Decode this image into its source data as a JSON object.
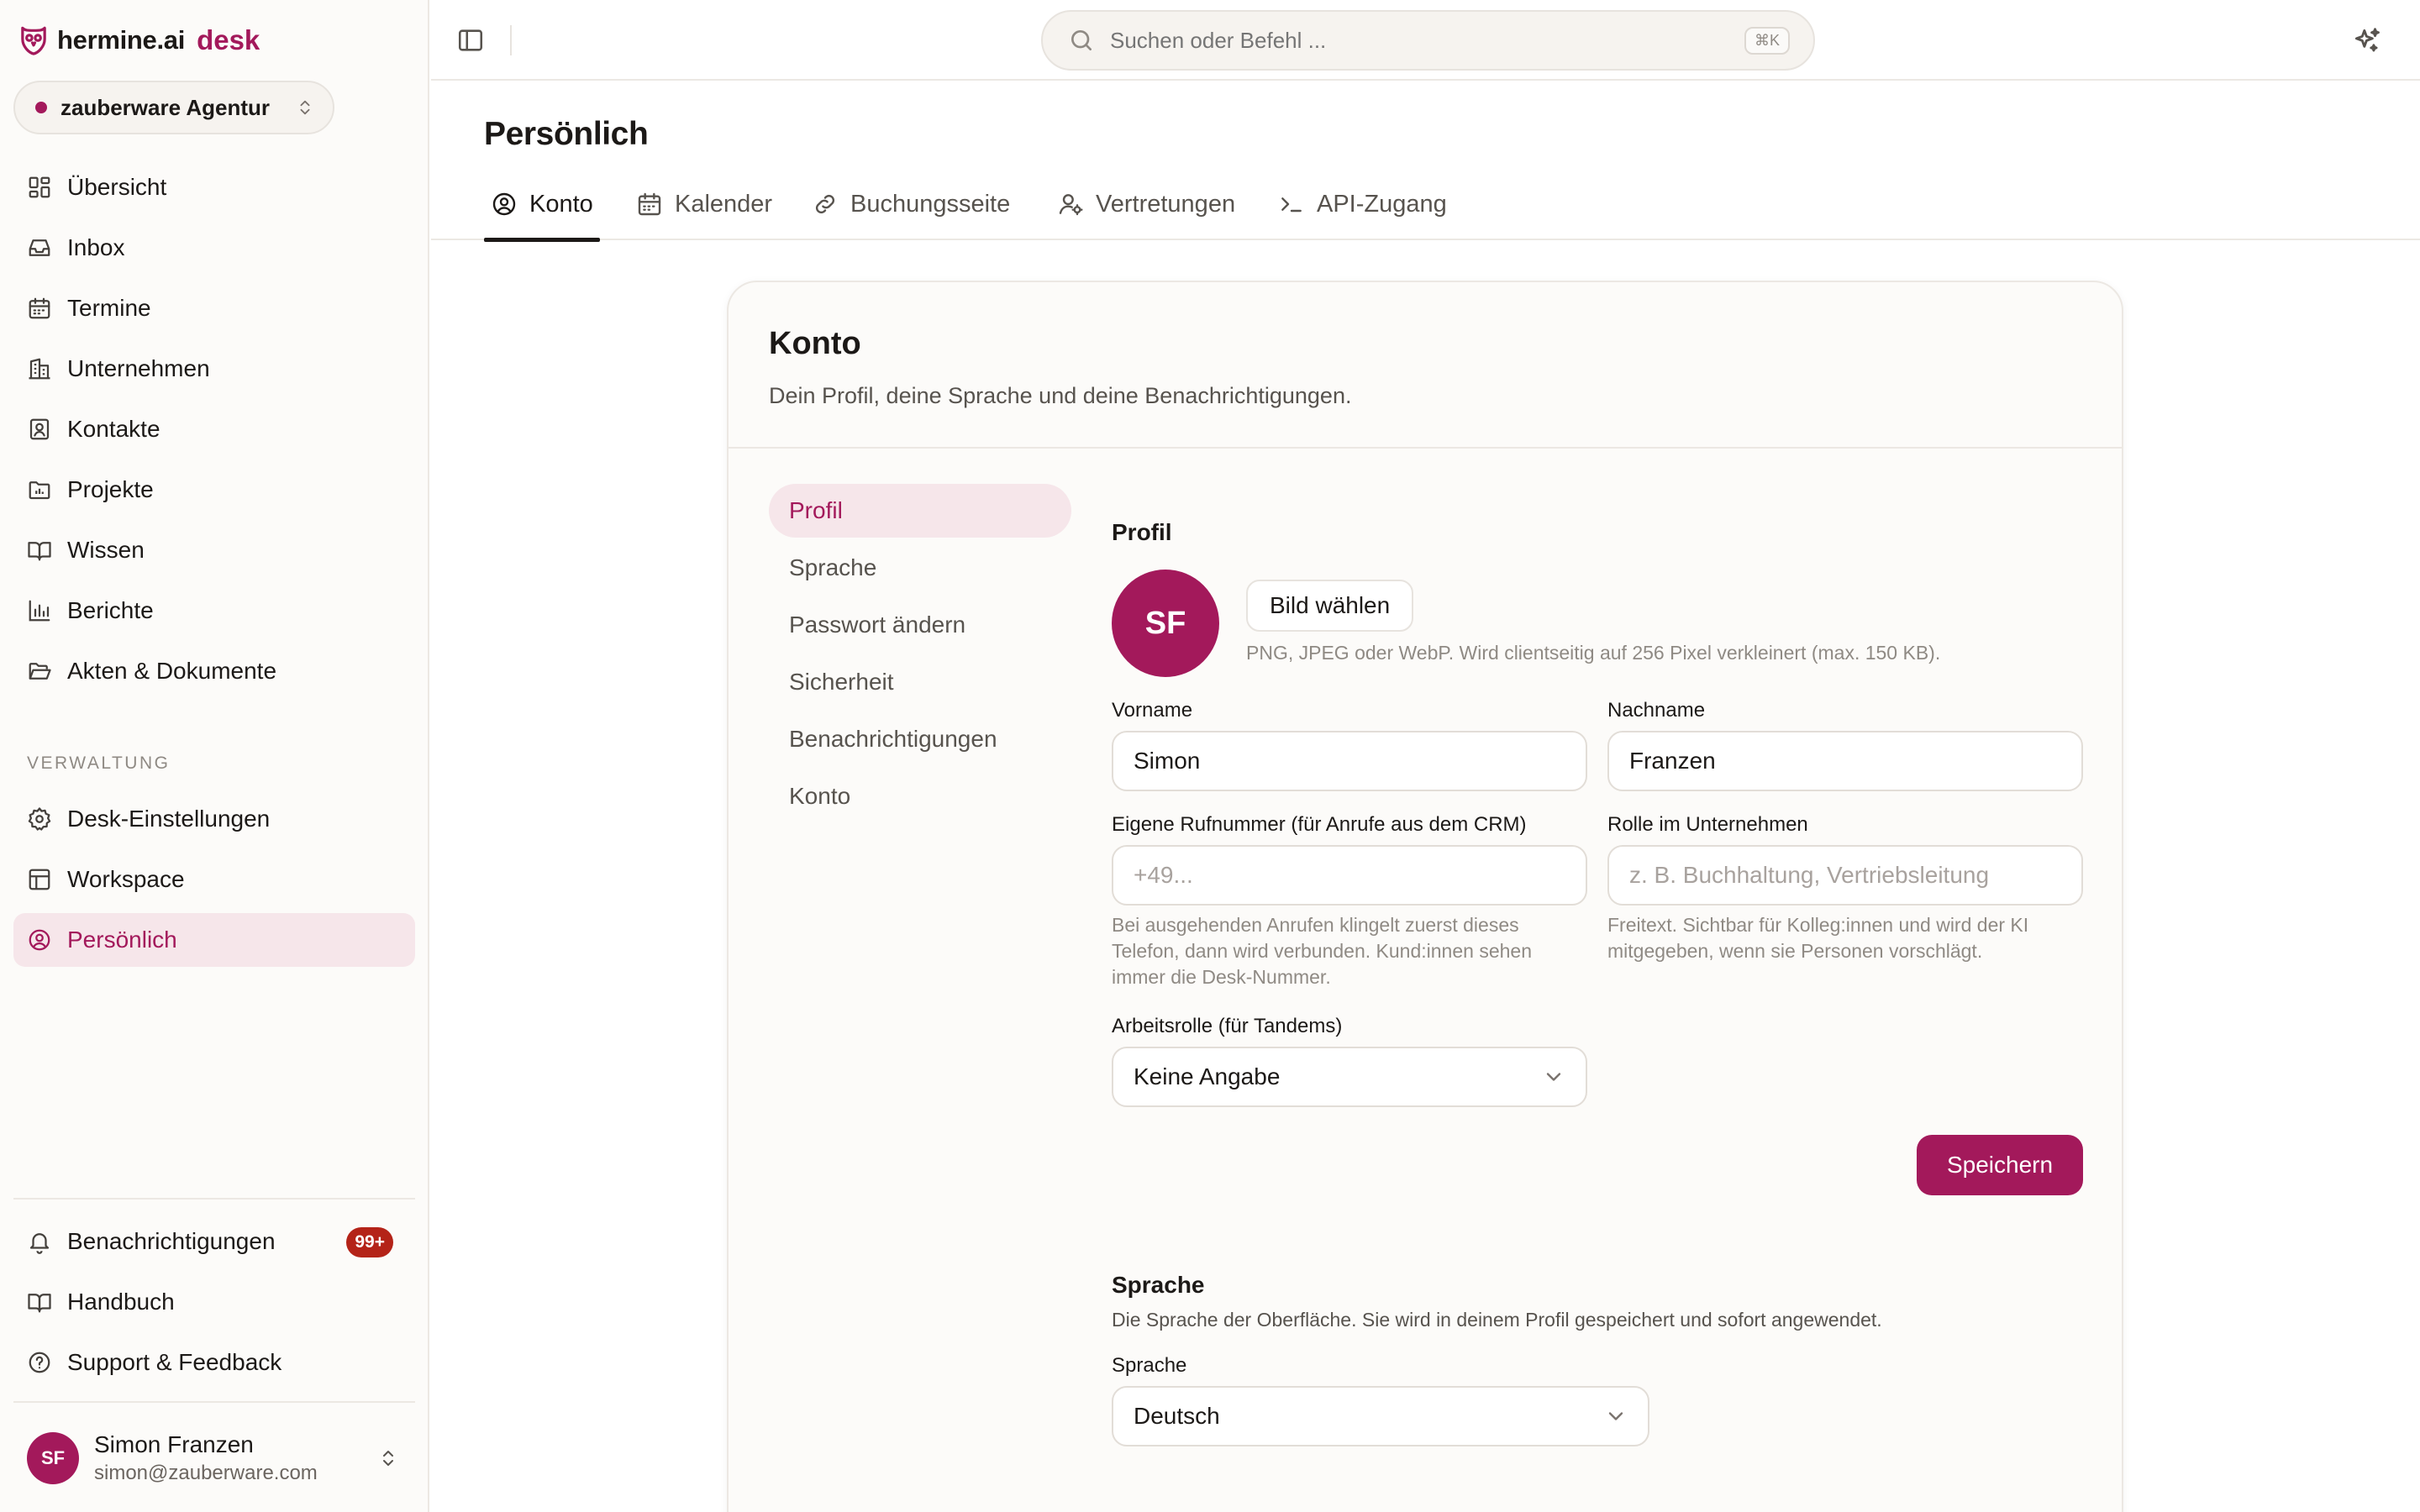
{
  "brand": {
    "name": "hermine.ai",
    "product": "desk"
  },
  "org_switcher": {
    "name": "zauberware Agentur"
  },
  "sidebar": {
    "nav": [
      {
        "label": "Übersicht",
        "icon": "dashboard-icon"
      },
      {
        "label": "Inbox",
        "icon": "inbox-icon"
      },
      {
        "label": "Termine",
        "icon": "calendar-icon"
      },
      {
        "label": "Unternehmen",
        "icon": "building-icon"
      },
      {
        "label": "Kontakte",
        "icon": "contact-icon"
      },
      {
        "label": "Projekte",
        "icon": "folder-chart-icon"
      },
      {
        "label": "Wissen",
        "icon": "book-icon"
      },
      {
        "label": "Berichte",
        "icon": "bar-chart-icon"
      },
      {
        "label": "Akten & Dokumente",
        "icon": "folder-open-icon"
      }
    ],
    "admin_section_label": "VERWALTUNG",
    "admin_nav": [
      {
        "label": "Desk-Einstellungen",
        "icon": "gear-icon"
      },
      {
        "label": "Workspace",
        "icon": "layout-icon"
      },
      {
        "label": "Persönlich",
        "icon": "user-circle-icon",
        "active": true
      }
    ],
    "bottom_nav": [
      {
        "label": "Benachrichtigungen",
        "icon": "bell-icon",
        "badge": "99+"
      },
      {
        "label": "Handbuch",
        "icon": "book-icon"
      },
      {
        "label": "Support & Feedback",
        "icon": "help-circle-icon"
      }
    ],
    "user": {
      "initials": "SF",
      "name": "Simon Franzen",
      "email": "simon@zauberware.com"
    }
  },
  "topbar": {
    "search_placeholder": "Suchen oder Befehl ...",
    "shortcut": "⌘K"
  },
  "page": {
    "title": "Persönlich",
    "tabs": [
      {
        "label": "Konto",
        "icon": "user-circle-icon",
        "active": true
      },
      {
        "label": "Kalender",
        "icon": "calendar-icon"
      },
      {
        "label": "Buchungsseite",
        "icon": "link-icon"
      },
      {
        "label": "Vertretungen",
        "icon": "user-gear-icon"
      },
      {
        "label": "API-Zugang",
        "icon": "terminal-icon"
      }
    ]
  },
  "card": {
    "title": "Konto",
    "description": "Dein Profil, deine Sprache und deine Benachrichtigungen.",
    "sub_nav": [
      "Profil",
      "Sprache",
      "Passwort ändern",
      "Sicherheit",
      "Benachrichtigungen",
      "Konto"
    ],
    "profile": {
      "heading": "Profil",
      "avatar_initials": "SF",
      "choose_image": "Bild wählen",
      "image_hint": "PNG, JPEG oder WebP. Wird clientseitig auf 256 Pixel verkleinert (max. 150 KB).",
      "first_name_label": "Vorname",
      "first_name_value": "Simon",
      "last_name_label": "Nachname",
      "last_name_value": "Franzen",
      "phone_label": "Eigene Rufnummer (für Anrufe aus dem CRM)",
      "phone_placeholder": "+49...",
      "phone_hint_lines": [
        "Bei ausgehenden Anrufen klingelt zuerst dieses",
        "Telefon, dann wird verbunden. Kund:innen sehen",
        "immer die Desk-Nummer."
      ],
      "role_label": "Rolle im Unternehmen",
      "role_placeholder": "z. B. Buchhaltung, Vertriebsleitung",
      "role_hint_lines": [
        "Freitext. Sichtbar für Kolleg:innen und wird der KI",
        "mitgegeben, wenn sie Personen vorschlägt."
      ],
      "work_role_label": "Arbeitsrolle (für Tandems)",
      "work_role_value": "Keine Angabe",
      "save": "Speichern"
    },
    "language": {
      "heading": "Sprache",
      "description": "Die Sprache der Oberfläche. Sie wird in deinem Profil gespeichert und sofort angewendet.",
      "label": "Sprache",
      "value": "Deutsch"
    }
  },
  "colors": {
    "accent": "#a3195b",
    "accent_soft": "#f6e6ea",
    "badge": "#b42318",
    "sidebar_bg": "#fcfbf9"
  }
}
